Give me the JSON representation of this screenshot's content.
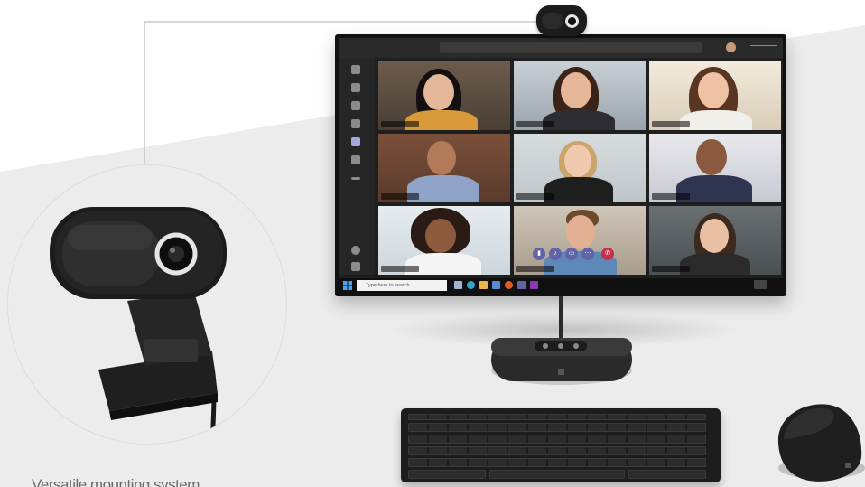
{
  "caption": "Versatile mounting system",
  "screen": {
    "taskbar_search_placeholder": "Type here to search"
  },
  "colors": {
    "teams_purple": "#6264a7",
    "hangup_red": "#c4314b",
    "device_black": "#1c1c1c",
    "backdrop_gray": "#ececec"
  }
}
